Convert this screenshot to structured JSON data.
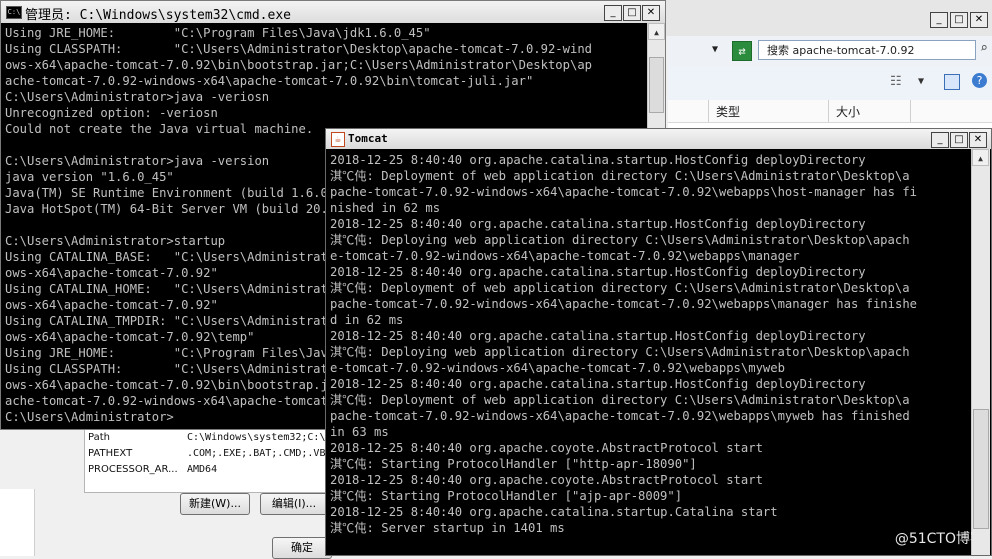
{
  "explorer": {
    "search_placeholder": "搜索 apache-tomcat-7.0.92",
    "columns": {
      "type": "类型",
      "size": "大小"
    }
  },
  "env_dialog": {
    "rows": [
      {
        "name": "Path",
        "value": "C:\\Windows\\system32;C:\\"
      },
      {
        "name": "PATHEXT",
        "value": ".COM;.EXE;.BAT;.CMD;.VB"
      },
      {
        "name": "PROCESSOR_AR...",
        "value": "AMD64"
      }
    ],
    "new_button": "新建(W)...",
    "edit_button": "编辑(I)...",
    "ok_button": "确定"
  },
  "cmd": {
    "title": "管理员: C:\\Windows\\system32\\cmd.exe",
    "lines": [
      "Using JRE_HOME:        \"C:\\Program Files\\Java\\jdk1.6.0_45\"",
      "Using CLASSPATH:       \"C:\\Users\\Administrator\\Desktop\\apache-tomcat-7.0.92-wind",
      "ows-x64\\apache-tomcat-7.0.92\\bin\\bootstrap.jar;C:\\Users\\Administrator\\Desktop\\ap",
      "ache-tomcat-7.0.92-windows-x64\\apache-tomcat-7.0.92\\bin\\tomcat-juli.jar\"",
      "C:\\Users\\Administrator>java -veriosn",
      "Unrecognized option: -veriosn",
      "Could not create the Java virtual machine.",
      "",
      "C:\\Users\\Administrator>java -version",
      "java version \"1.6.0_45\"",
      "Java(TM) SE Runtime Environment (build 1.6.0_45-b06)",
      "Java HotSpot(TM) 64-Bit Server VM (build 20.45-b01, mixed mode)",
      "",
      "C:\\Users\\Administrator>startup",
      "Using CATALINA_BASE:   \"C:\\Users\\Administrator\\Desktop\\apache-tomcat-7.0.92-wind",
      "ows-x64\\apache-tomcat-7.0.92\"",
      "Using CATALINA_HOME:   \"C:\\Users\\Administrator\\Desktop\\apache-tomcat-7.0.92-wind",
      "ows-x64\\apache-tomcat-7.0.92\"",
      "Using CATALINA_TMPDIR: \"C:\\Users\\Administrator\\Desktop\\apache-tomcat-7.0.92-wind",
      "ows-x64\\apache-tomcat-7.0.92\\temp\"",
      "Using JRE_HOME:        \"C:\\Program Files\\Java\\jdk1.6.0_45\"",
      "Using CLASSPATH:       \"C:\\Users\\Administrator\\Desktop\\apache-tomcat-7.0.92-wind",
      "ows-x64\\apache-tomcat-7.0.92\\bin\\bootstrap.jar;C:\\Users\\Administrator\\Desktop\\ap",
      "ache-tomcat-7.0.92-windows-x64\\apache-tomcat-7.0.92\\bin\\tomcat-juli.jar\"",
      "C:\\Users\\Administrator>"
    ]
  },
  "tomcat": {
    "title": "Tomcat",
    "lines": [
      "2018-12-25 8:40:40 org.apache.catalina.startup.HostConfig deployDirectory",
      "淇℃伅: Deployment of web application directory C:\\Users\\Administrator\\Desktop\\a",
      "pache-tomcat-7.0.92-windows-x64\\apache-tomcat-7.0.92\\webapps\\host-manager has fi",
      "nished in 62 ms",
      "2018-12-25 8:40:40 org.apache.catalina.startup.HostConfig deployDirectory",
      "淇℃伅: Deploying web application directory C:\\Users\\Administrator\\Desktop\\apach",
      "e-tomcat-7.0.92-windows-x64\\apache-tomcat-7.0.92\\webapps\\manager",
      "2018-12-25 8:40:40 org.apache.catalina.startup.HostConfig deployDirectory",
      "淇℃伅: Deployment of web application directory C:\\Users\\Administrator\\Desktop\\a",
      "pache-tomcat-7.0.92-windows-x64\\apache-tomcat-7.0.92\\webapps\\manager has finishe",
      "d in 62 ms",
      "2018-12-25 8:40:40 org.apache.catalina.startup.HostConfig deployDirectory",
      "淇℃伅: Deploying web application directory C:\\Users\\Administrator\\Desktop\\apach",
      "e-tomcat-7.0.92-windows-x64\\apache-tomcat-7.0.92\\webapps\\myweb",
      "2018-12-25 8:40:40 org.apache.catalina.startup.HostConfig deployDirectory",
      "淇℃伅: Deployment of web application directory C:\\Users\\Administrator\\Desktop\\a",
      "pache-tomcat-7.0.92-windows-x64\\apache-tomcat-7.0.92\\webapps\\myweb has finished",
      "in 63 ms",
      "2018-12-25 8:40:40 org.apache.coyote.AbstractProtocol start",
      "淇℃伅: Starting ProtocolHandler [\"http-apr-18090\"]",
      "2018-12-25 8:40:40 org.apache.coyote.AbstractProtocol start",
      "淇℃伅: Starting ProtocolHandler [\"ajp-apr-8009\"]",
      "2018-12-25 8:40:40 org.apache.catalina.startup.Catalina start",
      "淇℃伅: Server startup in 1401 ms"
    ]
  },
  "watermark": "@51CTO博客"
}
